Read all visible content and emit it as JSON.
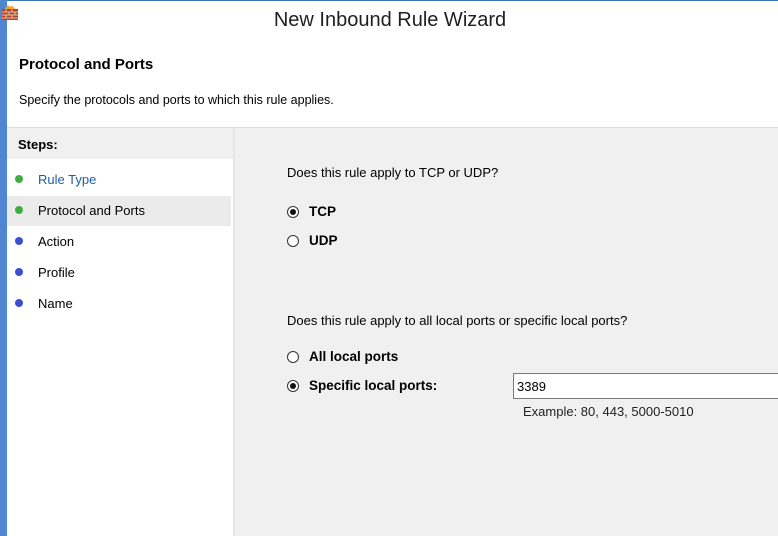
{
  "window": {
    "title": "New Inbound Rule Wizard",
    "icon": "firewall-icon",
    "accent_color": "#3c74c4"
  },
  "header": {
    "title": "Protocol and Ports",
    "subtitle": "Specify the protocols and ports to which this rule applies."
  },
  "steps": {
    "heading": "Steps:",
    "items": [
      {
        "label": "Rule Type",
        "status": "done",
        "dot_color": "#3fae3f",
        "text_color": "#1c5ea8"
      },
      {
        "label": "Protocol and Ports",
        "status": "current",
        "dot_color": "#3fae3f",
        "text_color": "#000000"
      },
      {
        "label": "Action",
        "status": "pending",
        "dot_color": "#3b4fd2",
        "text_color": "#000000"
      },
      {
        "label": "Profile",
        "status": "pending",
        "dot_color": "#3b4fd2",
        "text_color": "#000000"
      },
      {
        "label": "Name",
        "status": "pending",
        "dot_color": "#3b4fd2",
        "text_color": "#000000"
      }
    ]
  },
  "protocol": {
    "question": "Does this rule apply to TCP or UDP?",
    "options": [
      {
        "label": "TCP",
        "selected": true
      },
      {
        "label": "UDP",
        "selected": false
      }
    ]
  },
  "ports": {
    "question": "Does this rule apply to all local ports or specific local ports?",
    "options": [
      {
        "label": "All local ports",
        "selected": false
      },
      {
        "label": "Specific local ports:",
        "selected": true
      }
    ],
    "value": "3389",
    "example": "Example: 80, 443, 5000-5010"
  }
}
